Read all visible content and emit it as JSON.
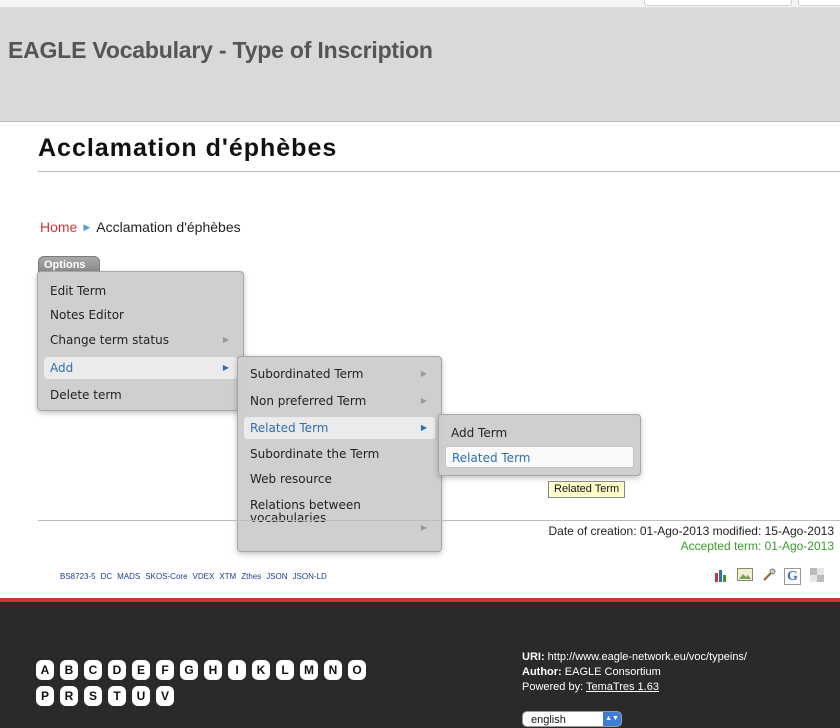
{
  "header": {
    "site_title": "EAGLE Vocabulary - Type of Inscription"
  },
  "term": {
    "title": "Acclamation d'éphèbes"
  },
  "breadcrumb": {
    "home": "Home",
    "current": "Acclamation d'éphèbes"
  },
  "options": {
    "label": "Options",
    "menu1": [
      "Edit Term",
      "Notes Editor",
      "Change term status",
      "Add",
      "Delete term"
    ],
    "menu2": [
      "Subordinated Term",
      "Non preferred Term",
      "Related Term",
      "Subordinate the Term",
      "Web resource",
      "Relations between vocabularies"
    ],
    "menu3": [
      "Add Term",
      "Related Term"
    ]
  },
  "tooltip": "Related Term",
  "dates": {
    "created": "Date of creation: 01-Ago-2013 modified: 15-Ago-2013",
    "accepted": "Accepted term: 01-Ago-2013"
  },
  "formats": [
    "BS8723-5",
    "DC",
    "MADS",
    "SKOS-Core",
    "VDEX",
    "XTM",
    "Zthes",
    "JSON",
    "JSON-LD"
  ],
  "letters_row1": [
    "A",
    "B",
    "C",
    "D",
    "E",
    "F",
    "G",
    "H",
    "I",
    "K",
    "L",
    "M",
    "N",
    "O"
  ],
  "letters_row2": [
    "P",
    "R",
    "S",
    "T",
    "U",
    "V"
  ],
  "footer": {
    "uri_label": "URI:",
    "uri_value": "http://www.eagle-network.eu/voc/typeins/",
    "author_label": "Author:",
    "author_value": "EAGLE Consortium",
    "powered_label": "Powered by:",
    "powered_value": "TemaTres 1.63",
    "language": "english"
  },
  "colors": {
    "accent_red": "#d0343a",
    "link_blue": "#2f6fb3",
    "accepted_green": "#3a9a2a",
    "footer_bg": "#2a2a2a"
  },
  "icons": [
    "chart-icon",
    "image-icon",
    "tools-icon",
    "google-icon",
    "delicious-icon"
  ]
}
